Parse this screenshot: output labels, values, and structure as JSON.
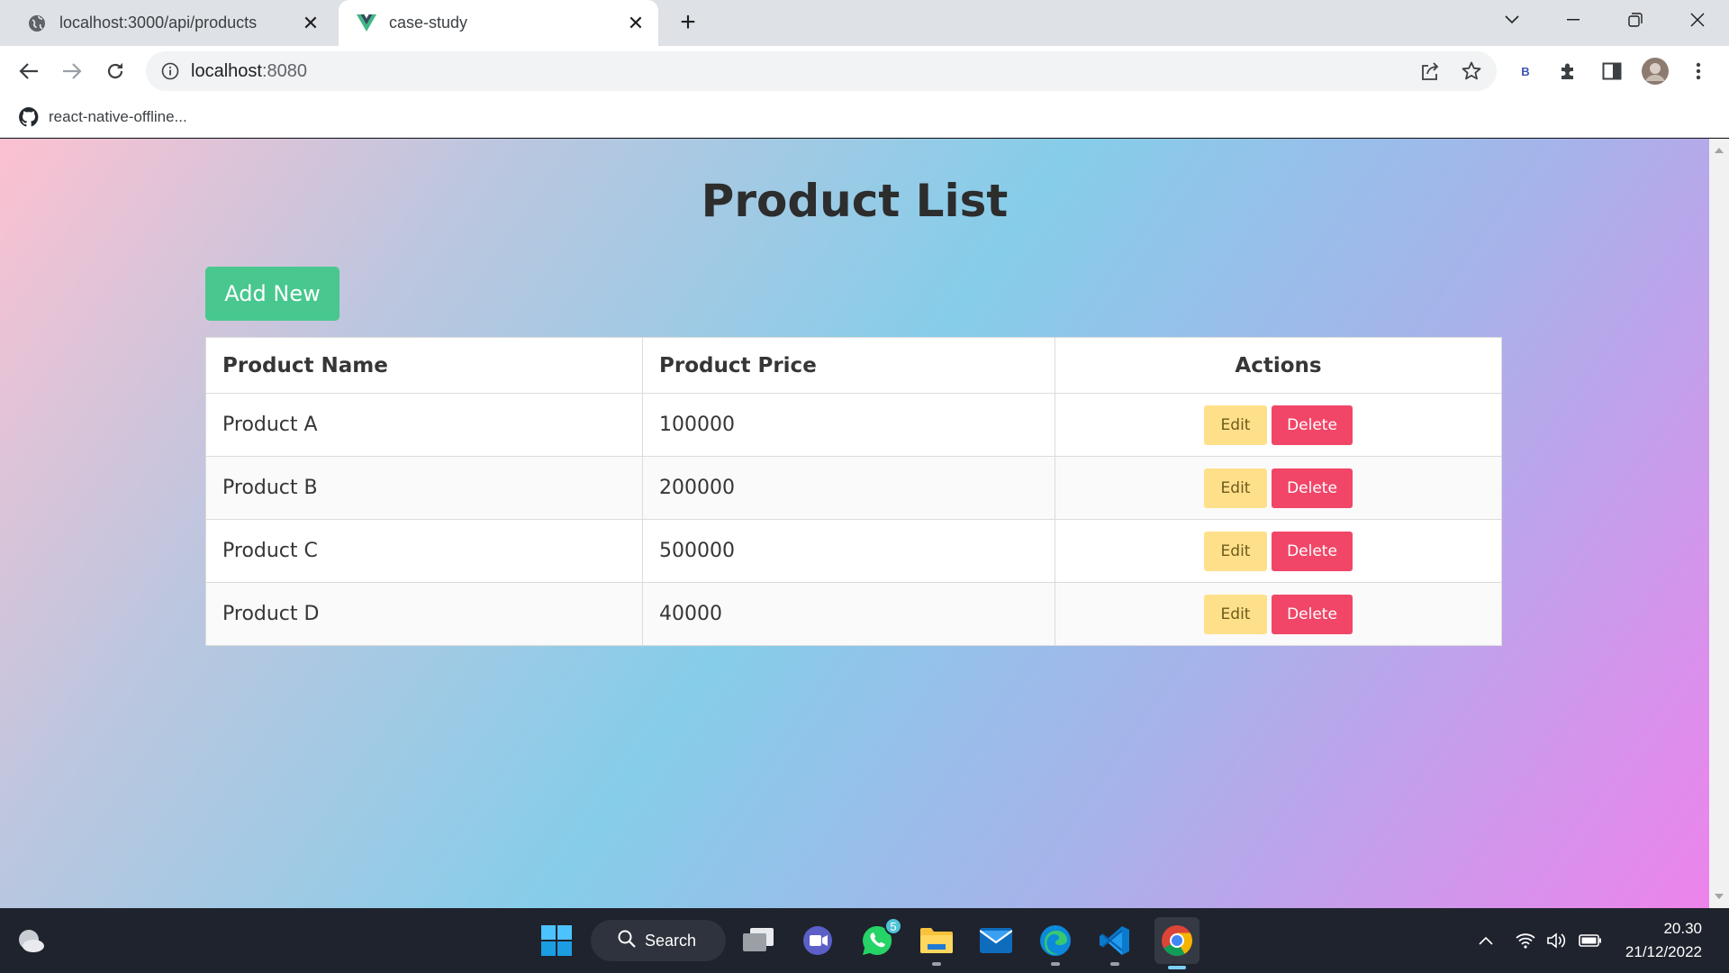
{
  "browser": {
    "tabs": [
      {
        "title": "localhost:3000/api/products",
        "icon": "globe-icon",
        "active": false
      },
      {
        "title": "case-study",
        "icon": "vue-logo-icon",
        "active": true
      }
    ],
    "address": {
      "host": "localhost",
      "port": ":8080"
    },
    "bookmarks": [
      {
        "label": "react-native-offline...",
        "icon": "github-icon"
      }
    ],
    "extension_badge": "B"
  },
  "page": {
    "title": "Product List",
    "add_button": "Add New",
    "table": {
      "headers": [
        "Product Name",
        "Product Price",
        "Actions"
      ],
      "rows": [
        {
          "name": "Product A",
          "price": "100000"
        },
        {
          "name": "Product B",
          "price": "200000"
        },
        {
          "name": "Product C",
          "price": "500000"
        },
        {
          "name": "Product D",
          "price": "40000"
        }
      ],
      "edit_label": "Edit",
      "delete_label": "Delete"
    },
    "colors": {
      "add": "#48c78e",
      "edit": "#ffe08a",
      "delete": "#f14668"
    }
  },
  "taskbar": {
    "search_label": "Search",
    "whatsapp_badge": "5",
    "time": "20.30",
    "date": "21/12/2022"
  }
}
